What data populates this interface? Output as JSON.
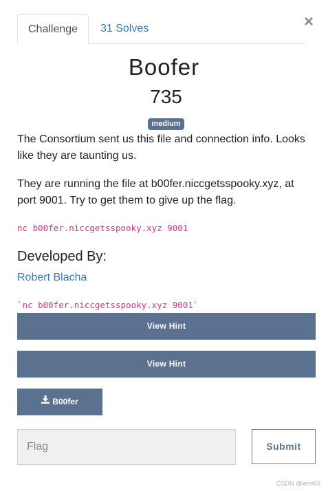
{
  "tabs": [
    {
      "label": "Challenge",
      "active": true
    },
    {
      "label": "31 Solves",
      "active": false
    }
  ],
  "close_symbol": "×",
  "challenge": {
    "name": "Boofer",
    "points": "735",
    "difficulty": "medium",
    "description": [
      "The Consortium sent us this file and connection info. Looks like they are taunting us.",
      "They are running the file at b00fer.niccgetsspooky.xyz, at port 9001. Try to get them to give up the flag."
    ],
    "connection_code": "nc b00fer.niccgetsspooky.xyz 9001",
    "developed_by_heading": "Developed By:",
    "developer": "Robert Blacha",
    "connection_info": "`nc b00fer.niccgetsspooky.xyz 9001`"
  },
  "hints": [
    {
      "label": "View Hint"
    },
    {
      "label": "View Hint"
    }
  ],
  "file": {
    "label": "B00fer",
    "icon": "download-icon"
  },
  "flag_form": {
    "placeholder": "Flag",
    "value": "",
    "submit_label": "Submit"
  },
  "watermark": "CSDN @wmr66",
  "colors": {
    "accent": "#5b7190",
    "link": "#337ab7",
    "code": "#d63384"
  }
}
